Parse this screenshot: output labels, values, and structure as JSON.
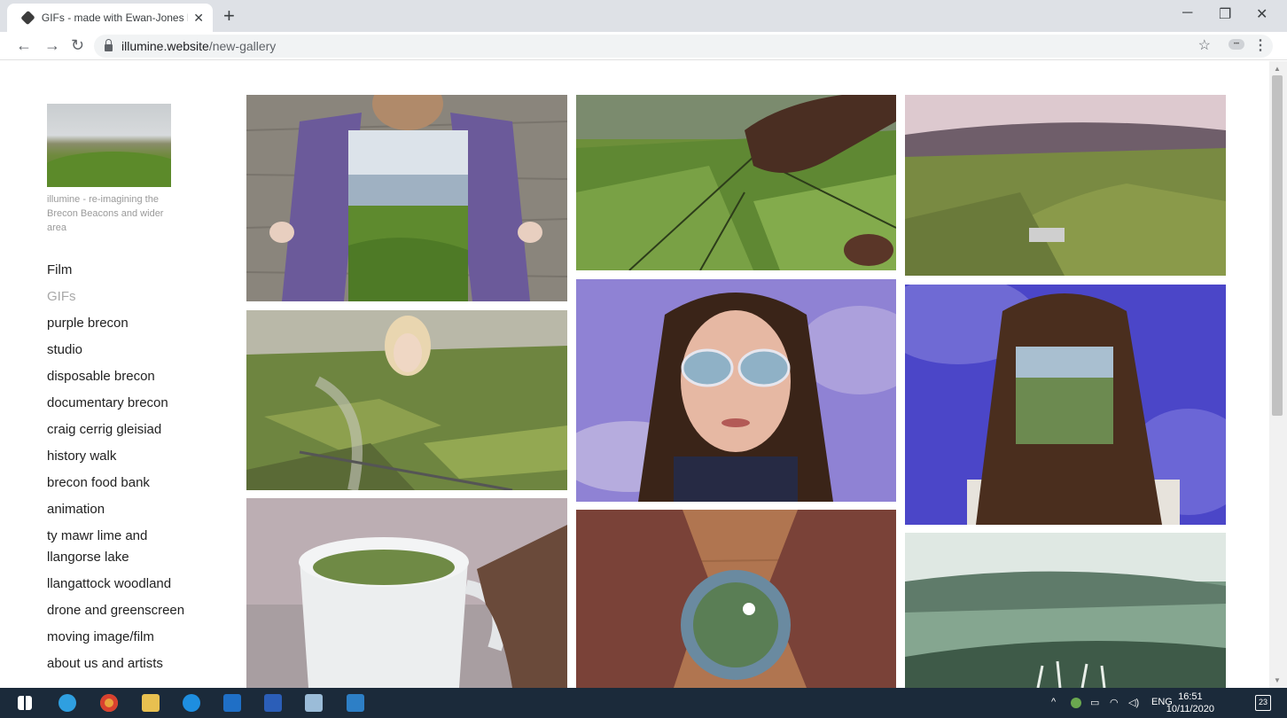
{
  "browser": {
    "tab_title": "GIFs - made with Ewan-Jones Mc",
    "url_host": "illumine.website",
    "url_path": "/new-gallery"
  },
  "sidebar": {
    "tagline": "illumine - re-imagining the Brecon Beacons and wider area",
    "nav": [
      {
        "label": "Film",
        "active": false
      },
      {
        "label": "GIFs",
        "active": true
      },
      {
        "label": "purple brecon",
        "active": false
      },
      {
        "label": "studio",
        "active": false
      },
      {
        "label": "disposable brecon",
        "active": false
      },
      {
        "label": "documentary brecon",
        "active": false
      },
      {
        "label": "craig cerrig gleisiad",
        "active": false
      },
      {
        "label": "history walk",
        "active": false
      },
      {
        "label": "brecon food bank",
        "active": false
      },
      {
        "label": "animation",
        "active": false
      },
      {
        "label": "ty mawr lime and llangorse lake",
        "active": false
      },
      {
        "label": "llangattock woodland",
        "active": false
      },
      {
        "label": "drone and greenscreen",
        "active": false
      },
      {
        "label": "moving image/film",
        "active": false
      },
      {
        "label": "about us and artists",
        "active": false
      }
    ]
  },
  "taskbar": {
    "language": "ENG",
    "time": "16:51",
    "date": "10/11/2020",
    "notifications": "23"
  },
  "colors": {
    "page_bg": "#ffffff",
    "nav_text": "#222222",
    "nav_active": "#a8a8a8",
    "tagline": "#9a9a9a",
    "taskbar": "#1b2a3a"
  }
}
